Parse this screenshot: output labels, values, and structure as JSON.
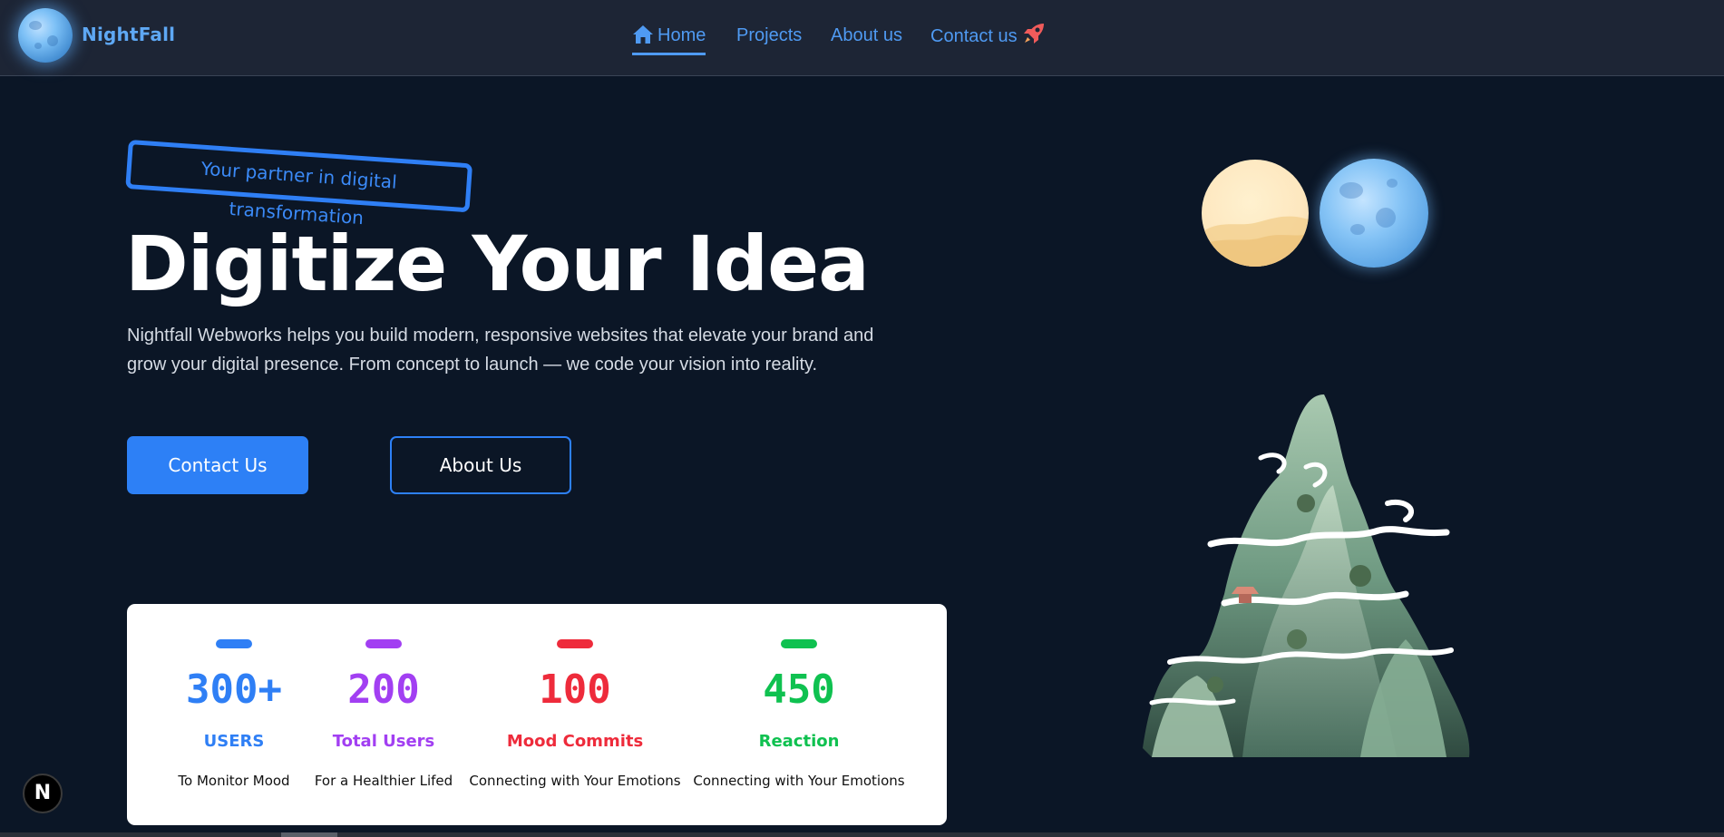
{
  "header": {
    "brand": "NightFall",
    "logo_icon": "moon-logo-icon",
    "nav": [
      {
        "label": "Home",
        "icon": "home-icon",
        "active": true
      },
      {
        "label": "Projects"
      },
      {
        "label": "About us"
      },
      {
        "label": "Contact us",
        "icon": "rocket-icon"
      }
    ]
  },
  "hero": {
    "tagline": "Your partner in digital transformation",
    "title": "Digitize Your Idea",
    "description": "Nightfall Webworks helps you build modern, responsive websites that elevate your brand and grow your digital presence. From concept to launch — we code your vision into reality.",
    "primary_button": "Contact Us",
    "secondary_button": "About Us"
  },
  "stats": [
    {
      "value": "300+",
      "label": "USERS",
      "sub": "To Monitor Mood",
      "color": "#2f7ff5"
    },
    {
      "value": "200",
      "label": "Total Users",
      "sub": "For a Healthier Lifed",
      "color": "#a23ff2"
    },
    {
      "value": "100",
      "label": "Mood Commits",
      "sub": "Connecting with Your Emotions",
      "color": "#ee2b3b"
    },
    {
      "value": "450",
      "label": "Reaction",
      "sub": "Connecting with Your Emotions",
      "color": "#0fc150"
    }
  ],
  "illustration": {
    "icons": [
      "sun-orb-icon",
      "moon-orb-icon",
      "mountain-illustration"
    ]
  },
  "dev_badge": "N",
  "colors": {
    "background": "#0b1626",
    "header": "#1d2535",
    "accent": "#2d80f6",
    "link": "#4f9af2"
  }
}
